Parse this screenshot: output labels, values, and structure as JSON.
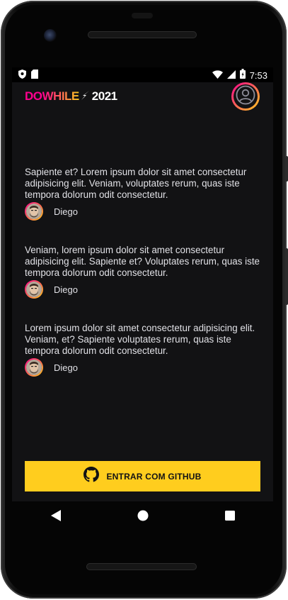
{
  "status_bar": {
    "time": "7:53",
    "left_icons": [
      "shield-icon",
      "sim-card-icon"
    ],
    "right_icons": [
      "wifi-icon",
      "signal-icon",
      "battery-icon"
    ]
  },
  "header": {
    "logo": {
      "do": "DO",
      "while": "WHILE",
      "year": "2021",
      "bolt": "⚡"
    },
    "user_avatar_icon": "user-circle-icon"
  },
  "messages": [
    {
      "text": "Sapiente et? Lorem ipsum dolor sit amet consectetur adipisicing elit. Veniam, voluptates rerum, quas iste tempora dolorum odit consectetur.",
      "user": "Diego"
    },
    {
      "text": "Veniam, lorem ipsum dolor sit amet consectetur adipisicing elit. Sapiente et? Voluptates rerum, quas iste tempora dolorum odit consectetur.",
      "user": "Diego"
    },
    {
      "text": "Lorem ipsum dolor sit amet consectetur adipisicing elit. Veniam, et? Sapiente voluptates rerum, quas iste tempora dolorum odit consectetur.",
      "user": "Diego"
    }
  ],
  "github_button": {
    "label": "ENTRAR COM GITHUB",
    "icon": "github-icon"
  },
  "colors": {
    "accent_yellow": "#ffcd1e",
    "accent_pink": "#ff008e",
    "background": "#121214",
    "text": "#e1e1e6"
  },
  "nav_bar": {
    "icons": [
      "back-icon",
      "home-icon",
      "recents-icon"
    ]
  }
}
